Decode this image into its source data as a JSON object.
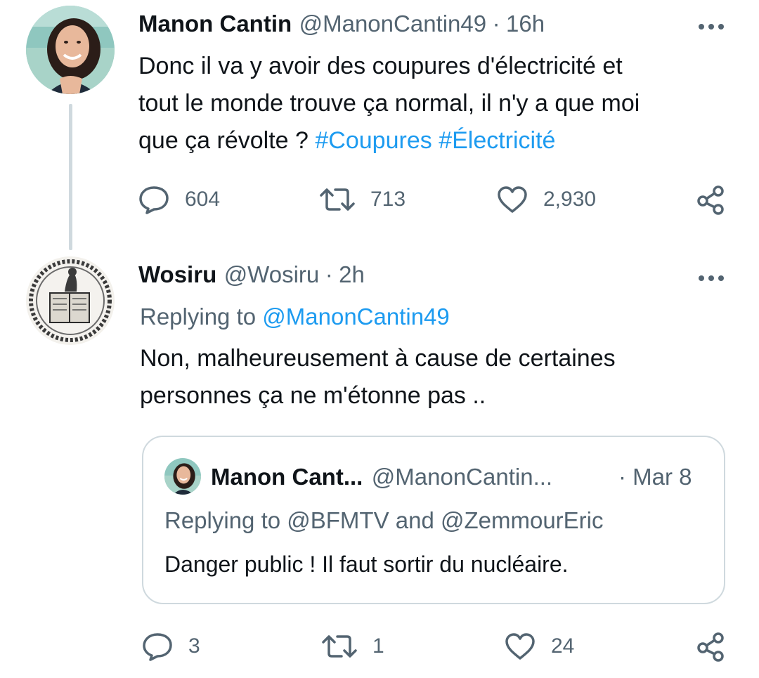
{
  "tweet": {
    "author_name": "Manon Cantin",
    "handle": "@ManonCantin49",
    "separator": "·",
    "time": "16h",
    "text_line1": "Donc il va y avoir des coupures d'électricité et",
    "text_line2": "tout le monde trouve ça normal, il n'y a que moi",
    "text_line3_plain": "que ça révolte ? ",
    "hashtag1": "#Coupures",
    "hashtag2": "#Électricité",
    "replies": "604",
    "retweets": "713",
    "likes": "2,930"
  },
  "reply": {
    "author_name": "Wosiru",
    "handle": "@Wosiru",
    "separator": "·",
    "time": "2h",
    "replying_prefix": "Replying to ",
    "replying_to": "@ManonCantin49",
    "text_line1": "Non, malheureusement à cause de certaines",
    "text_line2": "personnes ça ne m'étonne pas ..",
    "replies": "3",
    "retweets": "1",
    "likes": "24"
  },
  "quoted": {
    "author_name": "Manon Cant...",
    "handle": "@ManonCantin...",
    "date": "· Mar 8",
    "replying_prefix": "Replying to ",
    "replying_to": "@BFMTV and @ZemmourEric",
    "text": "Danger public ! Il faut sortir du nucléaire."
  },
  "icons": {
    "more": "more-icon",
    "reply": "reply-icon",
    "retweet": "retweet-icon",
    "like": "like-icon",
    "share": "share-icon"
  },
  "colors": {
    "text": "#0f1419",
    "secondary": "#536471",
    "link": "#1d9bf0",
    "border": "#cfd9de"
  }
}
